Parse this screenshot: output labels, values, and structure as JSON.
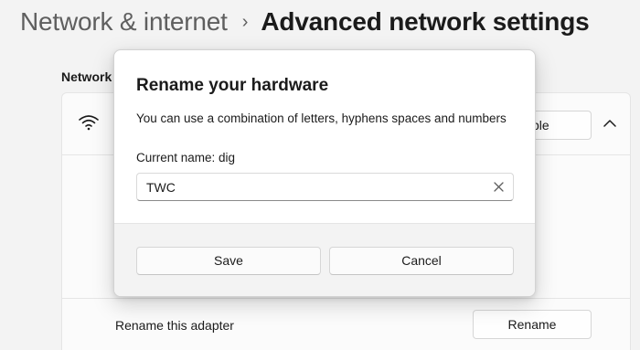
{
  "header": {
    "parent": "Network & internet",
    "separator": "›",
    "current": "Advanced network settings"
  },
  "background": {
    "section_label": "Network",
    "disable_button_label": "Disable",
    "rename_row_label": "Rename this adapter",
    "rename_button_label": "Rename"
  },
  "dialog": {
    "title": "Rename your hardware",
    "description": "You can use a combination of letters, hyphens spaces and numbers",
    "current_name": "Current name: dig",
    "input_value": "TWC",
    "save_label": "Save",
    "cancel_label": "Cancel"
  },
  "icons": {
    "wifi": "wifi-icon",
    "chevron": "chevron-up-icon",
    "clear": "close-icon"
  },
  "colors": {
    "background": "#f3f3f3",
    "dialog": "#ffffff",
    "text": "#1b1b1b",
    "muted": "#5f5f5f"
  }
}
